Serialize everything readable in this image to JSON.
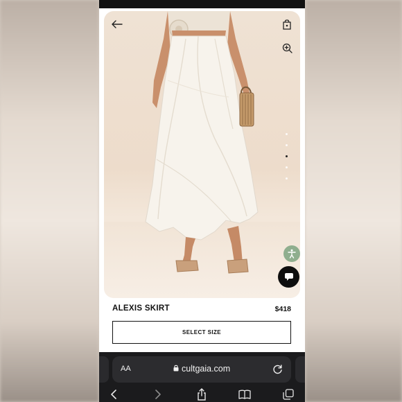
{
  "product": {
    "name": "ALEXIS SKIRT",
    "price": "$418",
    "select_size_label": "SELECT SIZE"
  },
  "gallery": {
    "image_count": 5,
    "active_index": 2
  },
  "browser": {
    "text_size_label": "AA",
    "url": "cultgaia.com"
  },
  "colors": {
    "accessibility_button": "#8fae8e",
    "chat_button": "#0e0e0e",
    "browser_bar": "#1b1b1d"
  },
  "icons": {
    "back": "arrow-left-icon",
    "bag": "shopping-bag-icon",
    "zoom": "zoom-in-icon",
    "accessibility": "accessibility-icon",
    "chat": "chat-icon",
    "lock": "lock-icon",
    "reload": "reload-icon",
    "nav_back": "chevron-left-icon",
    "nav_forward": "chevron-right-icon",
    "share": "share-icon",
    "bookmarks": "book-icon",
    "tabs": "tabs-icon"
  }
}
